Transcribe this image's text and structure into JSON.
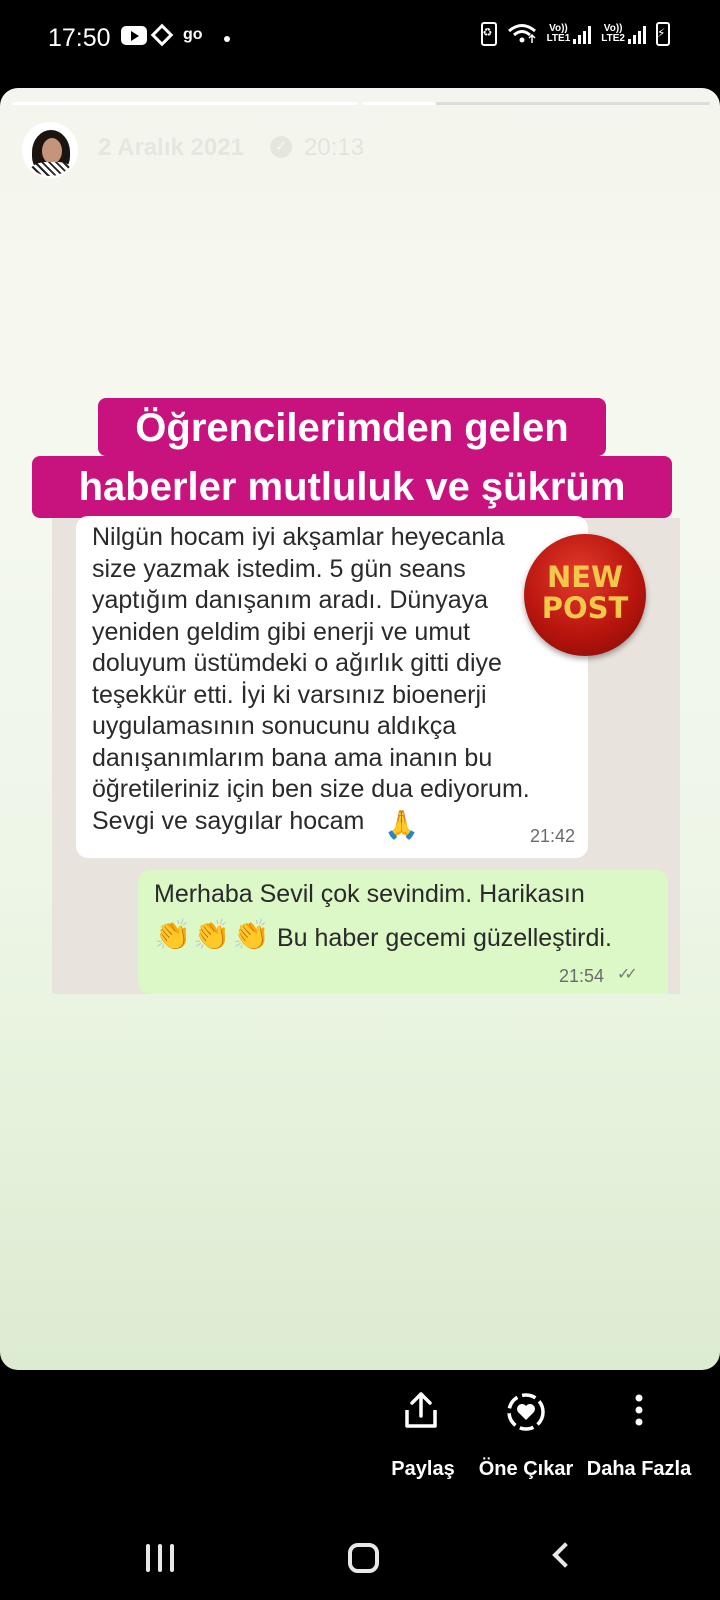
{
  "status_bar": {
    "time": "17:50",
    "notif_icons": [
      "youtube-icon",
      "binance-icon",
      "go-icon"
    ],
    "go_label": "go",
    "sim1": "Vo))\nLTE1",
    "sim2": "Vo))\nLTE2"
  },
  "story": {
    "date": "2 Aralık 2021",
    "time": "20:13",
    "progress_segments": 2,
    "headline_line1": "Öğrencilerimden gelen",
    "headline_line2": "haberler mutluluk ve şükrüm",
    "badge_text": "NEW\nPOST",
    "incoming_message": "Nilgün hocam iyi akşamlar heyecanla\nsize yazmak istedim. 5 gün seans\nyaptığım danışanım aradı. Dünyaya\nyeniden geldim gibi enerji ve umut\ndoluyum üstümdeki o ağırlık gitti diye\nteşekkür etti. İyi ki varsınız bioenerji\nuygulamasının sonucunu aldıkça\ndanışanımlarım bana ama inanın bu\nöğretileriniz için ben size dua ediyorum.\nSevgi ve saygılar hocam",
    "incoming_emoji": "🙏",
    "incoming_time": "21:42",
    "outgoing_line1": "Merhaba Sevil çok sevindim. Harikasın",
    "outgoing_emoji": "👏👏👏",
    "outgoing_line2": "Bu haber gecemi güzelleştirdi.",
    "outgoing_time": "21:54",
    "outgoing_ticks": "✓✓"
  },
  "actions": {
    "share": "Paylaş",
    "highlight": "Öne Çıkar",
    "more": "Daha Fazla"
  },
  "colors": {
    "headline_bg": "#c8127e",
    "badge_red": "#b8150d",
    "badge_text": "#f2c84a",
    "outgoing_bubble": "#dcf8c6"
  }
}
